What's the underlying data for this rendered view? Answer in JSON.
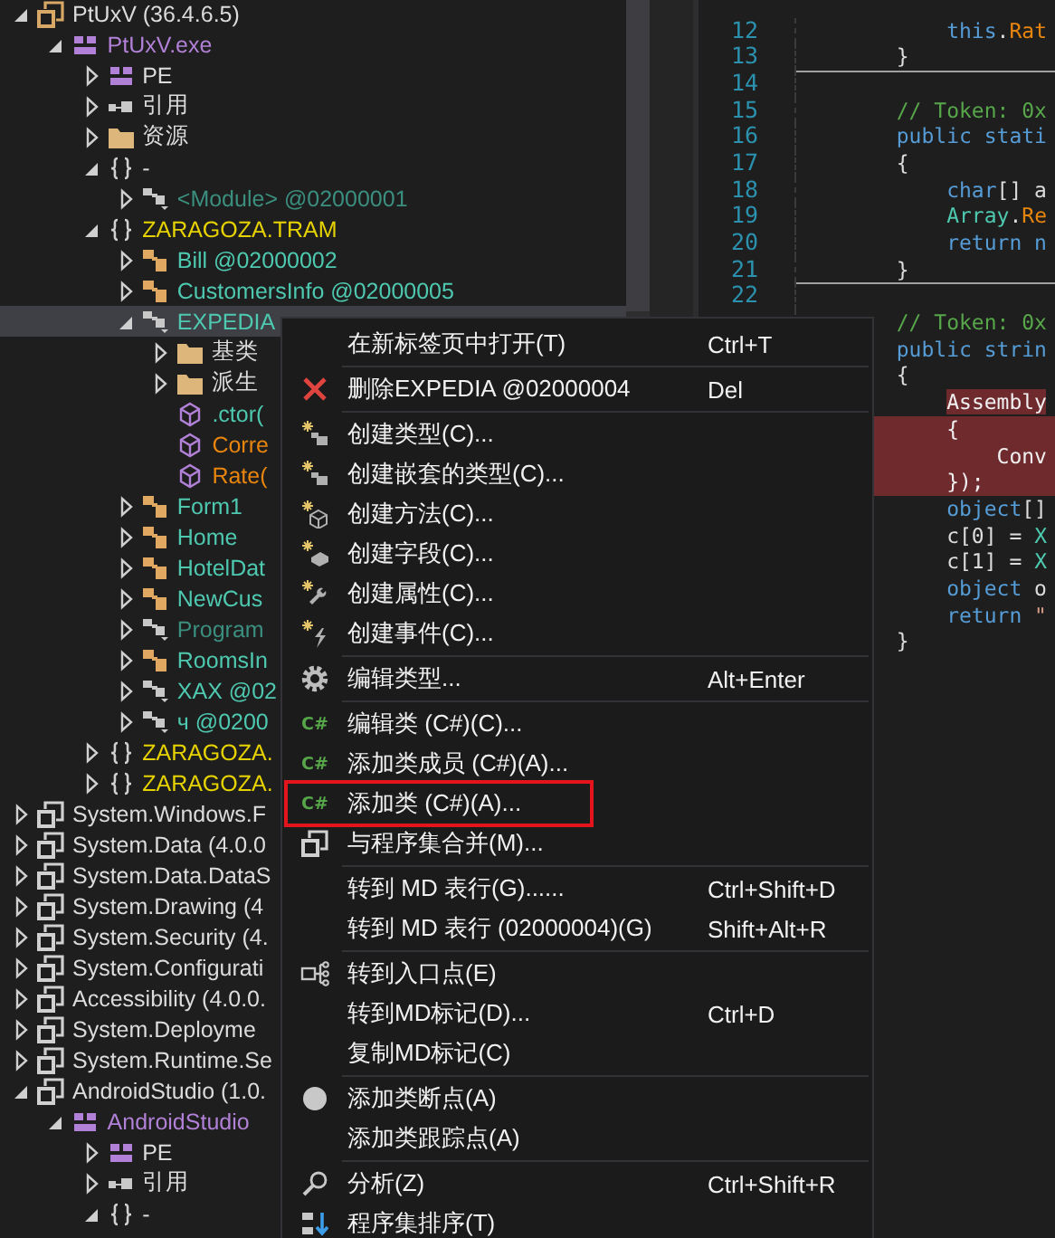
{
  "tree": [
    {
      "label": "PtUxV (36.4.6.5)",
      "kind": "assembly",
      "expanded": true,
      "selected": false,
      "children": [
        {
          "label": "PtUxV.exe",
          "kind": "module",
          "expanded": true,
          "selected": false,
          "children": [
            {
              "label": "PE",
              "kind": "pe",
              "expanded": false,
              "selected": false
            },
            {
              "label": "引用",
              "kind": "references",
              "expanded": false,
              "selected": false
            },
            {
              "label": "资源",
              "kind": "folder",
              "expanded": false,
              "selected": false
            },
            {
              "label": "-",
              "kind": "global-namespace",
              "expanded": true,
              "selected": false,
              "children": [
                {
                  "label": "<Module> @02000001",
                  "kind": "class-hidden",
                  "expanded": false,
                  "selected": false
                }
              ]
            },
            {
              "label": "ZARAGOZA.TRAM",
              "kind": "namespace",
              "expanded": true,
              "selected": false,
              "children": [
                {
                  "label": "Bill @02000002",
                  "kind": "class",
                  "expanded": false,
                  "selected": false
                },
                {
                  "label": "CustomersInfo @02000005",
                  "kind": "class",
                  "expanded": false,
                  "selected": false
                },
                {
                  "label": "EXPEDIA",
                  "kind": "class-internal",
                  "expanded": true,
                  "selected": true,
                  "children": [
                    {
                      "label": "基类",
                      "kind": "folder",
                      "expanded": false,
                      "selected": false
                    },
                    {
                      "label": "派生",
                      "kind": "folder",
                      "expanded": false,
                      "selected": false
                    },
                    {
                      "label": ".ctor(",
                      "kind": "constructor",
                      "selected": false
                    },
                    {
                      "label": "Corre",
                      "kind": "method",
                      "selected": false
                    },
                    {
                      "label": "Rate(",
                      "kind": "method",
                      "selected": false
                    }
                  ]
                },
                {
                  "label": "Form1",
                  "kind": "class",
                  "expanded": false,
                  "selected": false
                },
                {
                  "label": "Home",
                  "kind": "class",
                  "expanded": false,
                  "selected": false
                },
                {
                  "label": "HotelDat",
                  "kind": "class",
                  "expanded": false,
                  "selected": false
                },
                {
                  "label": "NewCus",
                  "kind": "class",
                  "expanded": false,
                  "selected": false
                },
                {
                  "label": "Program",
                  "kind": "class-hidden",
                  "expanded": false,
                  "selected": false
                },
                {
                  "label": "RoomsIn",
                  "kind": "class",
                  "expanded": false,
                  "selected": false
                },
                {
                  "label": "XAX @02",
                  "kind": "class-internal",
                  "expanded": false,
                  "selected": false
                },
                {
                  "label": "ч @0200",
                  "kind": "class-internal",
                  "expanded": false,
                  "selected": false
                }
              ]
            },
            {
              "label": "ZARAGOZA.",
              "kind": "namespace",
              "expanded": false,
              "selected": false
            },
            {
              "label": "ZARAGOZA.",
              "kind": "namespace",
              "expanded": false,
              "selected": false
            }
          ]
        }
      ]
    },
    {
      "label": "System.Windows.F",
      "kind": "library",
      "expanded": false,
      "selected": false
    },
    {
      "label": "System.Data (4.0.0",
      "kind": "library",
      "expanded": false,
      "selected": false
    },
    {
      "label": "System.Data.DataS",
      "kind": "library",
      "expanded": false,
      "selected": false
    },
    {
      "label": "System.Drawing (4",
      "kind": "library",
      "expanded": false,
      "selected": false
    },
    {
      "label": "System.Security (4.",
      "kind": "library",
      "expanded": false,
      "selected": false
    },
    {
      "label": "System.Configurati",
      "kind": "library",
      "expanded": false,
      "selected": false
    },
    {
      "label": "Accessibility (4.0.0.",
      "kind": "library",
      "expanded": false,
      "selected": false
    },
    {
      "label": "System.Deployme",
      "kind": "library",
      "expanded": false,
      "selected": false
    },
    {
      "label": "System.Runtime.Se",
      "kind": "library",
      "expanded": false,
      "selected": false
    },
    {
      "label": "AndroidStudio (1.0.",
      "kind": "library",
      "expanded": true,
      "selected": false,
      "children": [
        {
          "label": "AndroidStudio",
          "kind": "module",
          "expanded": true,
          "selected": false,
          "children": [
            {
              "label": "PE",
              "kind": "pe",
              "expanded": false,
              "selected": false
            },
            {
              "label": "引用",
              "kind": "references",
              "expanded": false,
              "selected": false
            },
            {
              "label": "-",
              "kind": "global-namespace",
              "expanded": true,
              "selected": false
            }
          ]
        }
      ]
    }
  ],
  "editor": {
    "lines": [
      {
        "number": "12",
        "divider": false,
        "highlighted": false,
        "tokens": [
          {
            "text": "            this",
            "kind": "keyword",
            "highlighted": false
          },
          {
            "text": ".",
            "kind": "plain",
            "highlighted": false
          },
          {
            "text": "Rat",
            "kind": "method",
            "highlighted": false
          }
        ]
      },
      {
        "number": "13",
        "divider": false,
        "highlighted": false,
        "tokens": [
          {
            "text": "        }",
            "kind": "plain",
            "highlighted": false
          }
        ]
      },
      {
        "number": "14",
        "divider": true,
        "highlighted": false
      },
      {
        "number": "15",
        "divider": false,
        "highlighted": false,
        "tokens": [
          {
            "text": "        // Token: 0x",
            "kind": "comment",
            "highlighted": false
          }
        ]
      },
      {
        "number": "16",
        "divider": false,
        "highlighted": false,
        "tokens": [
          {
            "text": "        public stati",
            "kind": "keyword",
            "highlighted": false
          }
        ]
      },
      {
        "number": "17",
        "divider": false,
        "highlighted": false,
        "tokens": [
          {
            "text": "        {",
            "kind": "plain",
            "highlighted": false
          }
        ]
      },
      {
        "number": "18",
        "divider": false,
        "highlighted": false,
        "tokens": [
          {
            "text": "            char",
            "kind": "keyword",
            "highlighted": false
          },
          {
            "text": "[] a",
            "kind": "plain",
            "highlighted": false
          }
        ]
      },
      {
        "number": "19",
        "divider": false,
        "highlighted": false,
        "tokens": [
          {
            "text": "            Array",
            "kind": "type",
            "highlighted": false
          },
          {
            "text": ".",
            "kind": "plain",
            "highlighted": false
          },
          {
            "text": "Re",
            "kind": "method",
            "highlighted": false
          }
        ]
      },
      {
        "number": "20",
        "divider": false,
        "highlighted": false,
        "tokens": [
          {
            "text": "            return n",
            "kind": "keyword",
            "highlighted": false
          }
        ]
      },
      {
        "number": "21",
        "divider": false,
        "highlighted": false,
        "tokens": [
          {
            "text": "        }",
            "kind": "plain",
            "highlighted": false
          }
        ]
      },
      {
        "number": "22",
        "divider": true,
        "highlighted": false
      },
      {
        "divider": false,
        "highlighted": false,
        "tokens": [
          {
            "text": "        // Token: 0x",
            "kind": "comment",
            "highlighted": false
          }
        ]
      },
      {
        "divider": false,
        "highlighted": false,
        "tokens": [
          {
            "text": "        public strin",
            "kind": "keyword",
            "highlighted": false
          }
        ]
      },
      {
        "divider": false,
        "highlighted": false,
        "tokens": [
          {
            "text": "        {",
            "kind": "plain",
            "highlighted": false
          }
        ]
      },
      {
        "divider": false,
        "highlighted": false,
        "tokens": [
          {
            "text": "            Assembly",
            "kind": "plain",
            "highlighted": true
          }
        ]
      },
      {
        "divider": false,
        "highlighted": true,
        "tokens": [
          {
            "text": "            {",
            "kind": "plain"
          }
        ]
      },
      {
        "divider": false,
        "highlighted": true,
        "tokens": [
          {
            "text": "                Conv",
            "kind": "plain"
          }
        ]
      },
      {
        "divider": false,
        "highlighted": true,
        "tokens": [
          {
            "text": "            });",
            "kind": "plain"
          }
        ]
      },
      {
        "divider": false,
        "highlighted": false,
        "tokens": [
          {
            "text": "            object",
            "kind": "keyword",
            "highlighted": false
          },
          {
            "text": "[]",
            "kind": "plain",
            "highlighted": false
          }
        ]
      },
      {
        "divider": false,
        "highlighted": false,
        "tokens": [
          {
            "text": "            c[0] = ",
            "kind": "plain",
            "highlighted": false
          },
          {
            "text": "X",
            "kind": "type",
            "highlighted": false
          }
        ]
      },
      {
        "divider": false,
        "highlighted": false,
        "tokens": [
          {
            "text": "            c[1] = ",
            "kind": "plain",
            "highlighted": false
          },
          {
            "text": "X",
            "kind": "type",
            "highlighted": false
          }
        ]
      },
      {
        "divider": false,
        "highlighted": false,
        "tokens": [
          {
            "text": "            object",
            "kind": "keyword",
            "highlighted": false
          },
          {
            "text": " o",
            "kind": "plain",
            "highlighted": false
          }
        ]
      },
      {
        "divider": false,
        "highlighted": false,
        "tokens": [
          {
            "text": "            return",
            "kind": "keyword",
            "highlighted": false
          },
          {
            "text": " \"",
            "kind": "string",
            "highlighted": false
          }
        ]
      },
      {
        "divider": false,
        "highlighted": false,
        "tokens": [
          {
            "text": "        }",
            "kind": "plain",
            "highlighted": false
          }
        ]
      }
    ]
  },
  "menu": {
    "items": [
      {
        "kind": "plain",
        "label": "在新标签页中打开(T)",
        "shortcut": "Ctrl+T",
        "annotated": false
      },
      {
        "kind": "separator"
      },
      {
        "kind": "delete",
        "label": "删除EXPEDIA @02000004",
        "shortcut": "Del",
        "annotated": false
      },
      {
        "kind": "separator"
      },
      {
        "kind": "new-type",
        "label": "创建类型(C)...",
        "annotated": false
      },
      {
        "kind": "new-type",
        "label": "创建嵌套的类型(C)...",
        "annotated": false
      },
      {
        "kind": "new-method",
        "label": "创建方法(C)...",
        "annotated": false
      },
      {
        "kind": "new-field",
        "label": "创建字段(C)...",
        "annotated": false
      },
      {
        "kind": "new-property",
        "label": "创建属性(C)...",
        "annotated": false
      },
      {
        "kind": "new-event",
        "label": "创建事件(C)...",
        "annotated": false
      },
      {
        "kind": "separator"
      },
      {
        "kind": "gear",
        "label": "编辑类型...",
        "shortcut": "Alt+Enter",
        "annotated": false
      },
      {
        "kind": "separator"
      },
      {
        "kind": "csharp",
        "badge": "C#",
        "label": "编辑类 (C#)(C)...",
        "annotated": false
      },
      {
        "kind": "csharp",
        "badge": "C#",
        "label": "添加类成员 (C#)(A)...",
        "annotated": false
      },
      {
        "kind": "csharp",
        "badge": "C#",
        "label": "添加类 (C#)(A)...",
        "annotated": true
      },
      {
        "kind": "merge",
        "label": "与程序集合并(M)...",
        "annotated": false
      },
      {
        "kind": "separator"
      },
      {
        "kind": "plain",
        "label": "转到 MD 表行(G)......",
        "shortcut": "Ctrl+Shift+D",
        "annotated": false
      },
      {
        "kind": "plain",
        "label": "转到 MD 表行 (02000004)(G)",
        "shortcut": "Shift+Alt+R",
        "annotated": false
      },
      {
        "kind": "separator"
      },
      {
        "kind": "entry",
        "label": "转到入口点(E)",
        "annotated": false
      },
      {
        "kind": "plain",
        "label": "转到MD标记(D)...",
        "shortcut": "Ctrl+D",
        "annotated": false
      },
      {
        "kind": "plain",
        "label": "复制MD标记(C)",
        "annotated": false
      },
      {
        "kind": "separator"
      },
      {
        "kind": "breakpoint",
        "label": "添加类断点(A)",
        "annotated": false
      },
      {
        "kind": "plain",
        "label": "添加类跟踪点(A)",
        "annotated": false
      },
      {
        "kind": "separator"
      },
      {
        "kind": "search",
        "label": "分析(Z)",
        "shortcut": "Ctrl+Shift+R",
        "annotated": false
      },
      {
        "kind": "sort",
        "label": "程序集排序(T)",
        "annotated": false
      }
    ]
  }
}
